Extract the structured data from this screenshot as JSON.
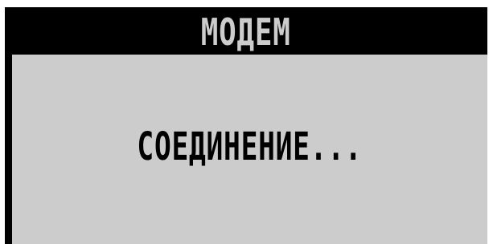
{
  "window": {
    "title": "МОДЕМ"
  },
  "dialog": {
    "status_text": "СОЕДИНЕНИЕ..."
  },
  "colors": {
    "title_bar_bg": "#000000",
    "title_text": "#cccccc",
    "body_bg": "#cccccc",
    "body_text": "#000000",
    "frame": "#000000"
  }
}
